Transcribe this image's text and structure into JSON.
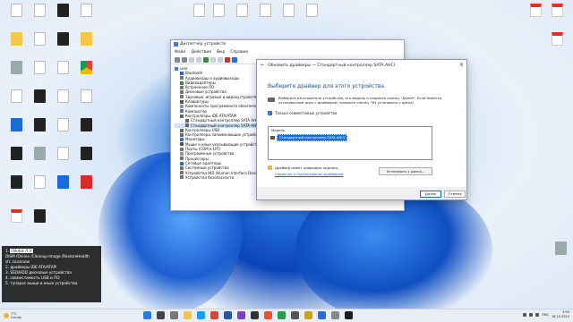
{
  "device_manager": {
    "title": "Диспетчер устройств",
    "menu": [
      "Файл",
      "Действие",
      "Вид",
      "Справка"
    ],
    "tree": [
      {
        "label": "user",
        "level": 0,
        "icon": "computer-icon"
      },
      {
        "label": "Bluetooth",
        "level": 1,
        "icon": "bluetooth-icon"
      },
      {
        "label": "Аудиовходы и аудиовыходы",
        "level": 1,
        "icon": "speaker-icon"
      },
      {
        "label": "Видеоадаптеры",
        "level": 1,
        "icon": "display-adapter-icon"
      },
      {
        "label": "Встроенное ПО",
        "level": 1,
        "icon": "chip-icon"
      },
      {
        "label": "Дисковые устройства",
        "level": 1,
        "icon": "disk-icon"
      },
      {
        "label": "Звуковые, игровые и видеоустройства",
        "level": 1,
        "icon": "sound-icon"
      },
      {
        "label": "Клавиатуры",
        "level": 1,
        "icon": "keyboard-icon"
      },
      {
        "label": "Компоненты программного обеспечения",
        "level": 1,
        "icon": "component-icon"
      },
      {
        "label": "Компьютер",
        "level": 1,
        "icon": "computer-icon"
      },
      {
        "label": "Контроллеры IDE ATA/ATAPI",
        "level": 1,
        "icon": "controller-icon"
      },
      {
        "label": "Стандартный контроллер SATA AHCI",
        "level": 2,
        "icon": "controller-icon"
      },
      {
        "label": "Стандартный контроллер SATA AHCI",
        "level": 2,
        "icon": "controller-icon"
      },
      {
        "label": "Контроллеры USB",
        "level": 1,
        "icon": "usb-icon"
      },
      {
        "label": "Контроллеры запоминающих устройств",
        "level": 1,
        "icon": "storage-icon"
      },
      {
        "label": "Мониторы",
        "level": 1,
        "icon": "monitor-icon"
      },
      {
        "label": "Мыши и иные указывающие устройства",
        "level": 1,
        "icon": "mouse-icon"
      },
      {
        "label": "Порты (COM и LPT)",
        "level": 1,
        "icon": "port-icon"
      },
      {
        "label": "Программные устройства",
        "level": 1,
        "icon": "software-device-icon"
      },
      {
        "label": "Процессоры",
        "level": 1,
        "icon": "cpu-icon"
      },
      {
        "label": "Сетевые адаптеры",
        "level": 1,
        "icon": "network-icon"
      },
      {
        "label": "Системные устройства",
        "level": 1,
        "icon": "system-icon"
      },
      {
        "label": "Устройства HID (Human Interface Devices)",
        "level": 1,
        "icon": "hid-icon"
      },
      {
        "label": "Устройства безопасности",
        "level": 1,
        "icon": "security-icon"
      }
    ]
  },
  "dialog": {
    "title": "Обновить драйверы — Стандартный контроллер SATA AHCI",
    "heading": "Выберите драйвер для этого устройства.",
    "intro": "Выберите изготовителя устройства, его модель и нажмите кнопку \"Далее\". Если имеется установочный диск с драйвером, нажмите кнопку \"Из установить с диска\".",
    "compat_label": "Только совместимые устройства",
    "model_header": "Модель",
    "model_item": "Стандартный контроллер SATA AHCI",
    "signed_text": "Драйвер имеет цифровую подпись.",
    "sign_link": "Сведения о подписывании драйверов",
    "have_disk": "Установить с диска...",
    "next": "Далее",
    "cancel": "Отмена"
  },
  "notes": {
    "line1_prefix": "1. ",
    "line1_hl": "chkdsk /f /r",
    "lines": [
      "DISM /Online /Cleanup-Image /RestoreHealth",
      "sfc /scannow",
      "2. драйверы IDE ATA/ATAPI",
      "3. SSD/HDD дисковые устройства",
      "4. совместимость USB и ПО",
      "5. тупарос мыши и иные устройства"
    ]
  },
  "taskbar": {
    "temp": "7°C",
    "weather": "Cloudy",
    "lang": "ENG",
    "time": "3:09",
    "date": "18.10.2024"
  },
  "colors": {
    "accent": "#1f6ed4",
    "heading": "#1f4e8c",
    "link": "#1b5fbf"
  }
}
